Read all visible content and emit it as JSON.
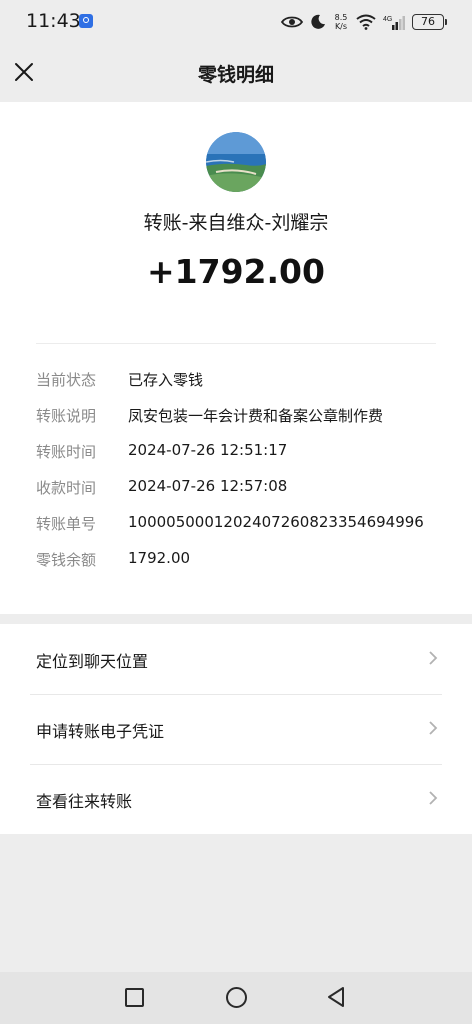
{
  "status_bar": {
    "time": "11:43",
    "net_speed_value": "8.5",
    "net_speed_unit": "K/s",
    "network_type": "4G",
    "battery": "76"
  },
  "header": {
    "title": "零钱明细",
    "close_icon": "close-icon"
  },
  "transaction": {
    "payer": "转账-来自维众-刘耀宗",
    "amount": "+1792.00",
    "details": [
      {
        "label": "当前状态",
        "value": "已存入零钱"
      },
      {
        "label": "转账说明",
        "value": "凤安包装一年会计费和备案公章制作费"
      },
      {
        "label": "转账时间",
        "value": "2024-07-26 12:51:17"
      },
      {
        "label": "收款时间",
        "value": "2024-07-26 12:57:08"
      },
      {
        "label": "转账单号",
        "value": "1000050001202407260823354694996"
      },
      {
        "label": "零钱余额",
        "value": "1792.00"
      }
    ]
  },
  "menu": {
    "items": [
      {
        "label": "定位到聊天位置"
      },
      {
        "label": "申请转账电子凭证"
      },
      {
        "label": "查看往来转账"
      }
    ]
  },
  "colors": {
    "background": "#ededed",
    "card": "#ffffff",
    "label_gray": "#8a8a8a",
    "text": "#191919"
  }
}
